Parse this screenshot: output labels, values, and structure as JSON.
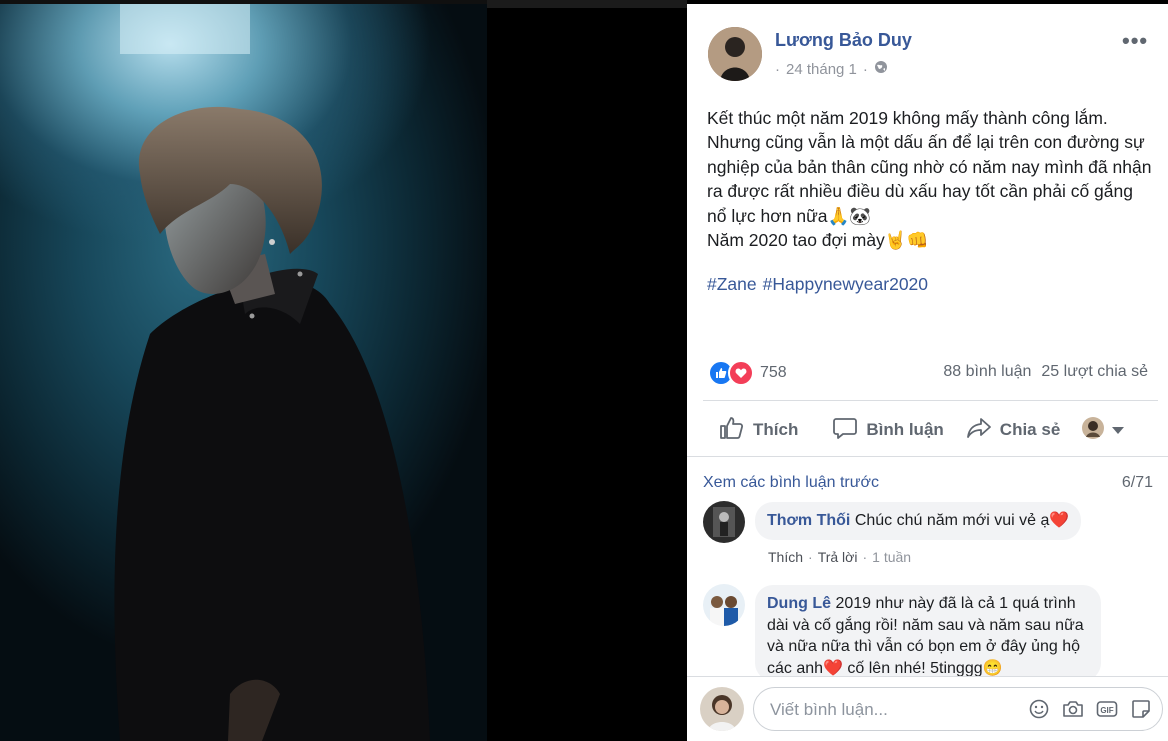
{
  "post": {
    "author": "Lương Bảo Duy",
    "date": "24 tháng 1",
    "separator": "·",
    "more_label": "•••",
    "text": "Kết thúc một năm 2019 không mấy thành công lắm. Nhưng cũng vẫn là một dấu ấn để lại trên con đường sự nghiệp của bản thân cũng nhờ có năm nay mình đã nhận ra được rất nhiều điều dù xấu hay tốt cần phải cố gắng nổ lực hơn nữa🙏🐼\nNăm 2020 tao đợi mày🤘👊",
    "hashtags": [
      "#Zane",
      "#Happynewyear2020"
    ]
  },
  "stats": {
    "reaction_count": "758",
    "comments": "88 bình luận",
    "shares": "25 lượt chia sẻ"
  },
  "actions": {
    "like": "Thích",
    "comment": "Bình luận",
    "share": "Chia sẻ"
  },
  "comments_section": {
    "view_previous": "Xem các bình luận trước",
    "pager": "6/71",
    "items": [
      {
        "author": "Thơm Thối",
        "text": "Chúc chú năm mới vui vẻ ạ❤️",
        "like": "Thích",
        "reply": "Trả lời",
        "dot": "·",
        "time": "1 tuần"
      },
      {
        "author": "Dung Lê",
        "text": "2019 như này đã là cả 1 quá trình dài và cố gắng rồi! năm sau và năm sau nữa và nữa nữa thì vẫn có bọn em ở đây ủng hộ các anh❤️ cố lên nhé! 5tinggg😁"
      }
    ]
  },
  "composer": {
    "placeholder": "Viết bình luận..."
  },
  "colors": {
    "link": "#385898",
    "like_blue": "#1877f2",
    "love_red": "#f33e58",
    "muted": "#606770"
  }
}
